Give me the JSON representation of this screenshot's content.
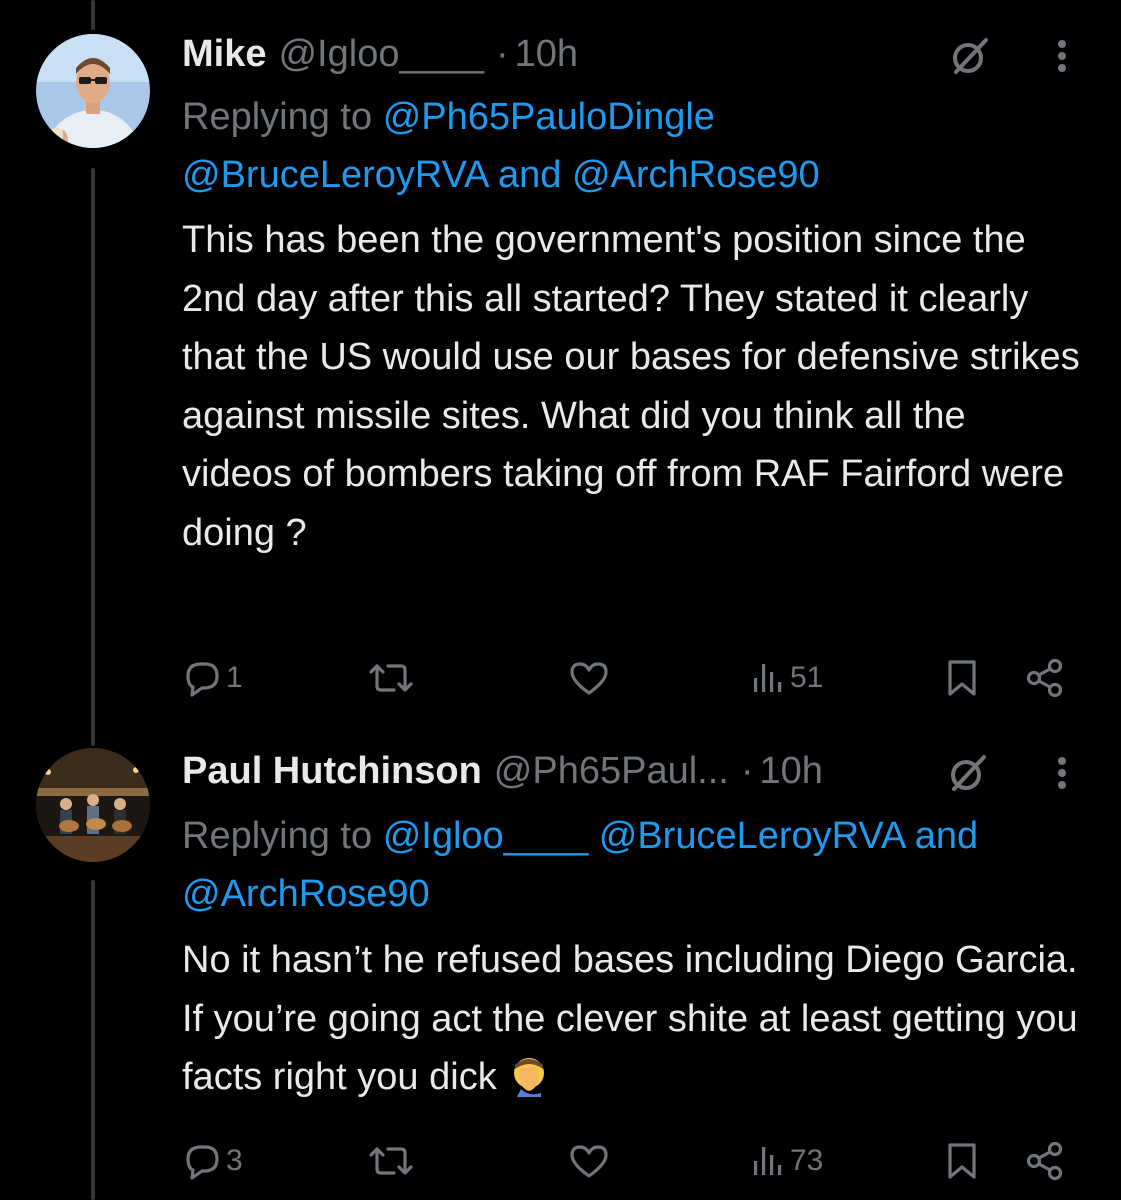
{
  "colors": {
    "background": "#000000",
    "text": "#e7e9ea",
    "secondary": "#71767b",
    "link": "#1d9bf0",
    "thread_line": "#333639"
  },
  "tweets": [
    {
      "name": "Mike",
      "handle": "@Igloo____",
      "dot": "·",
      "time": "10h",
      "replying_prefix": "Replying to",
      "replying_mentions": [
        "@Ph65PauloDingle",
        "@BruceLeroyRVA"
      ],
      "replying_and": "and",
      "replying_last": "@ArchRose90",
      "text": "This has been the government's position since the 2nd day after this all started? They stated it clearly that the US would use our bases for defensive strikes against missile sites. What did you think all the videos of bombers taking off from RAF Fairford were doing ?",
      "reply_count": "1",
      "repost_count": "",
      "like_count": "",
      "view_count": "51",
      "icons": [
        "grok-icon",
        "more-icon",
        "reply-icon",
        "repost-icon",
        "like-icon",
        "views-icon",
        "bookmark-icon",
        "share-icon"
      ]
    },
    {
      "name": "Paul Hutchinson",
      "handle": "@Ph65Paul...",
      "dot": "·",
      "time": "10h",
      "replying_prefix": "Replying to",
      "replying_mentions": [
        "@Igloo____",
        "@BruceLeroyRVA"
      ],
      "replying_and": "and",
      "replying_last": "@ArchRose90",
      "text": "No it hasn’t he refused bases including Diego Garcia. If you’re going act the clever shite at least getting you facts right you dick",
      "emoji": "facepalm",
      "reply_count": "3",
      "repost_count": "",
      "like_count": "",
      "view_count": "73",
      "icons": [
        "grok-icon",
        "more-icon",
        "reply-icon",
        "repost-icon",
        "like-icon",
        "views-icon",
        "bookmark-icon",
        "share-icon"
      ]
    }
  ]
}
